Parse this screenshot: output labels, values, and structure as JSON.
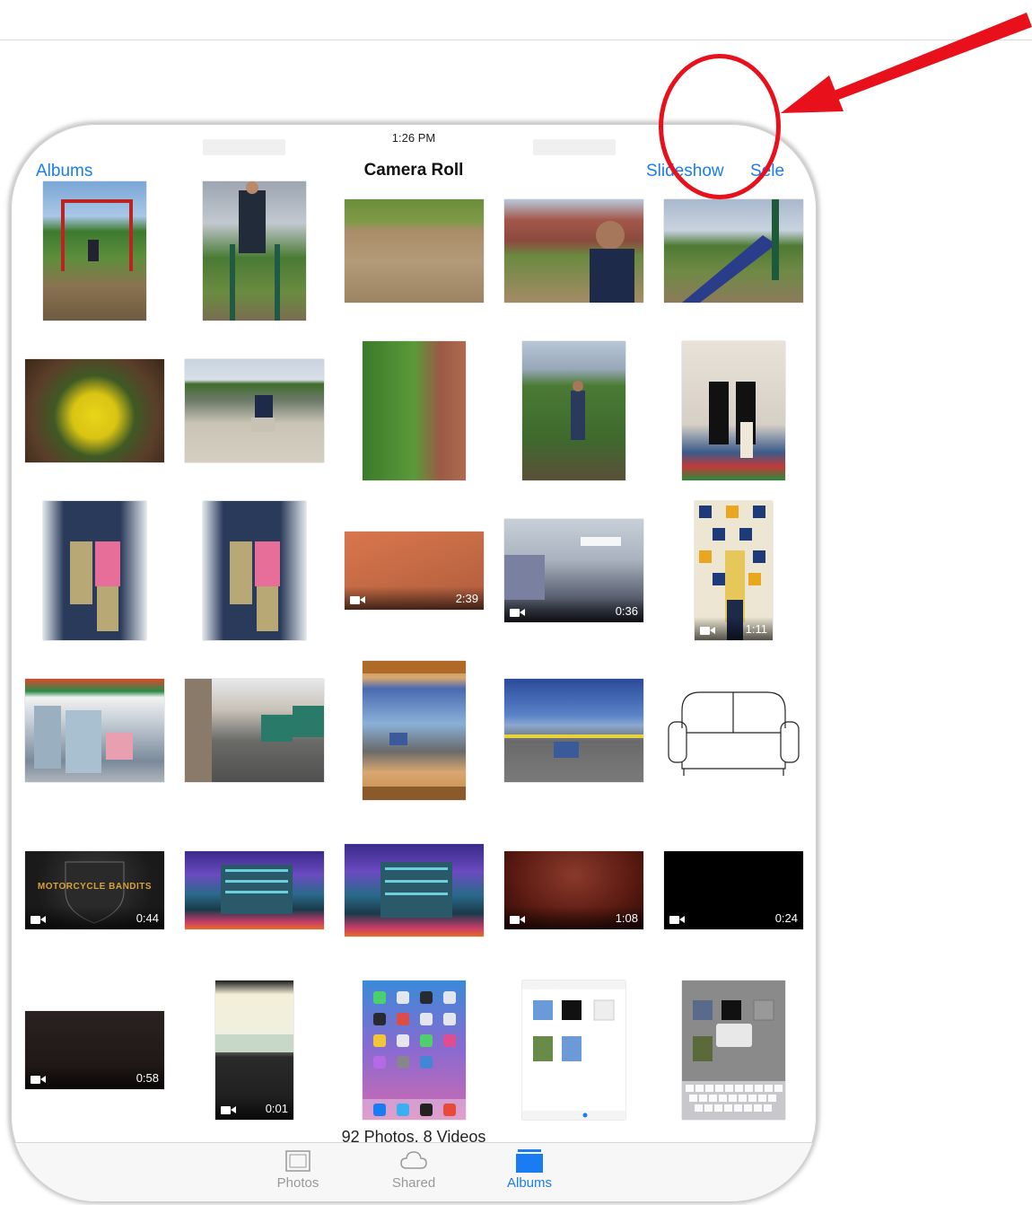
{
  "status_bar": {
    "time": "1:26 PM"
  },
  "nav": {
    "back_label": "Albums",
    "title": "Camera Roll",
    "slideshow_label": "Slideshow",
    "select_label": "Sele"
  },
  "summary": "92 Photos, 8 Videos",
  "tabs": [
    {
      "label": "Photos",
      "icon": "photos-icon"
    },
    {
      "label": "Shared",
      "icon": "cloud-icon"
    },
    {
      "label": "Albums",
      "icon": "albums-icon"
    }
  ],
  "grid": {
    "items": [
      {
        "kind": "photo",
        "desc": "swing-set"
      },
      {
        "kind": "photo",
        "desc": "boy-on-bars"
      },
      {
        "kind": "photo",
        "desc": "playground-ground"
      },
      {
        "kind": "photo",
        "desc": "boy-smiling"
      },
      {
        "kind": "photo",
        "desc": "slide"
      },
      {
        "kind": "photo",
        "desc": "yellow-flowers"
      },
      {
        "kind": "photo",
        "desc": "boy-on-sidewalk"
      },
      {
        "kind": "photo",
        "desc": "bush"
      },
      {
        "kind": "photo",
        "desc": "boy-by-tree"
      },
      {
        "kind": "photo",
        "desc": "classroom-women"
      },
      {
        "kind": "photo",
        "desc": "two-women-1"
      },
      {
        "kind": "photo",
        "desc": "two-women-2"
      },
      {
        "kind": "video",
        "desc": "orange-blur",
        "duration": "2:39"
      },
      {
        "kind": "video",
        "desc": "classroom-ceiling",
        "duration": "0:36"
      },
      {
        "kind": "video",
        "desc": "girl-by-wall",
        "duration": "1:11"
      },
      {
        "kind": "photo",
        "desc": "store-front"
      },
      {
        "kind": "photo",
        "desc": "alley"
      },
      {
        "kind": "photo",
        "desc": "app-screenshot"
      },
      {
        "kind": "photo",
        "desc": "road-photo"
      },
      {
        "kind": "photo",
        "desc": "sofa-drawing"
      },
      {
        "kind": "video",
        "desc": "motorcycle-bandits",
        "duration": "0:44",
        "text": "MOTORCYCLE BANDITS"
      },
      {
        "kind": "photo",
        "desc": "building-night-1"
      },
      {
        "kind": "photo",
        "desc": "building-night-2"
      },
      {
        "kind": "video",
        "desc": "dark-red-blur",
        "duration": "1:08"
      },
      {
        "kind": "video",
        "desc": "black",
        "duration": "0:24"
      },
      {
        "kind": "video",
        "desc": "dark-brown",
        "duration": "0:58"
      },
      {
        "kind": "video",
        "desc": "close-up",
        "duration": "0:01"
      },
      {
        "kind": "photo",
        "desc": "ipad-home-screen"
      },
      {
        "kind": "photo",
        "desc": "ipad-albums-screen"
      },
      {
        "kind": "photo",
        "desc": "ipad-albums-dialog"
      }
    ]
  },
  "colors": {
    "accent": "#1a7cf3",
    "annotation": "#e8101a"
  }
}
